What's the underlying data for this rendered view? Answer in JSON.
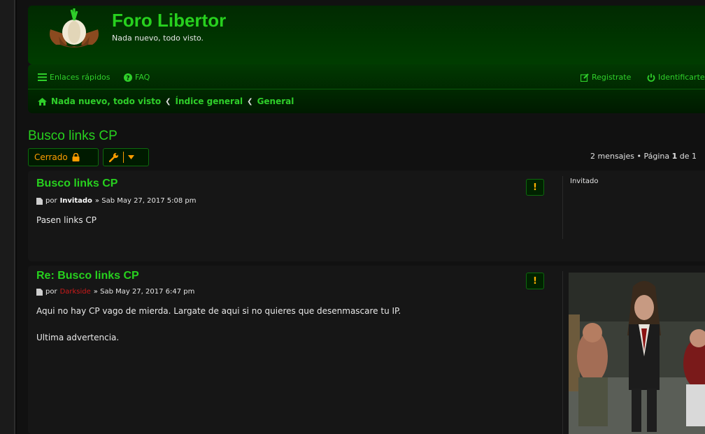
{
  "site": {
    "title": "Foro Libertor",
    "description": "Nada nuevo, todo visto."
  },
  "nav": {
    "quick_links": "Enlaces rápidos",
    "faq": "FAQ",
    "register": "Registrate",
    "login": "Identificarte"
  },
  "breadcrumbs": [
    "Nada nuevo, todo visto",
    "Índice general",
    "General"
  ],
  "topic": {
    "title": "Busco links CP",
    "locked_label": "Cerrado",
    "pagination": {
      "prefix": "2 mensajes • Página ",
      "current": "1",
      "suffix": " de 1"
    }
  },
  "posts": [
    {
      "title": "Busco links CP",
      "by": "por",
      "author": "Invitado",
      "date": "» Sab May 27, 2017 5:08 pm",
      "body": [
        "Pasen links CP"
      ],
      "profile_name": "Invitado",
      "author_color": "#ffffff"
    },
    {
      "title": "Re: Busco links CP",
      "by": "por",
      "author": "Darkside",
      "date": "» Sab May 27, 2017 6:47 pm",
      "body": [
        "Aqui no hay CP vago de mierda. Largate de aqui si no quieres que desenmascare tu IP.",
        "Ultima advertencia."
      ],
      "author_color": "#cc1a1a"
    }
  ],
  "colors": {
    "accent": "#27d11e",
    "warning": "#ff9d00"
  }
}
